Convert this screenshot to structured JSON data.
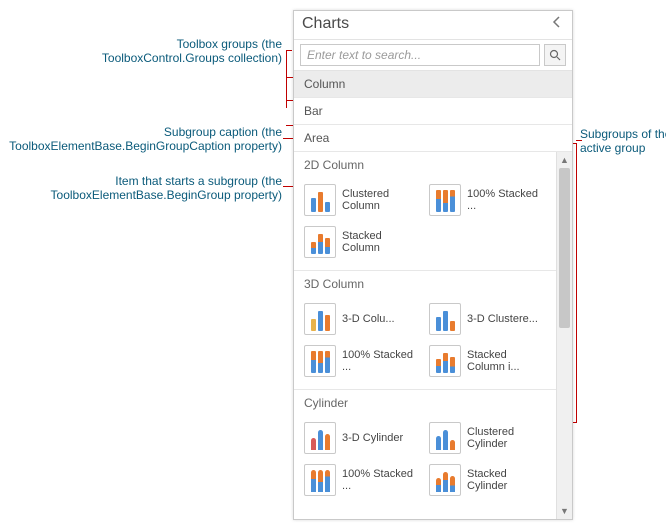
{
  "panel": {
    "title": "Charts"
  },
  "search": {
    "placeholder": "Enter text to search..."
  },
  "groups": {
    "column": "Column",
    "bar": "Bar",
    "area": "Area"
  },
  "subgroups": {
    "s2d": {
      "caption": "2D Column",
      "items": {
        "clustered": "Clustered Column",
        "stacked100": "100% Stacked ...",
        "stacked": "Stacked Column"
      }
    },
    "s3d": {
      "caption": "3D Column",
      "items": {
        "col3d": "3-D Colu...",
        "clust3d": "3-D Clustere...",
        "stacked100_3d": "100% Stacked ...",
        "stackedin": "Stacked Column i..."
      }
    },
    "cyl": {
      "caption": "Cylinder",
      "items": {
        "cyl3d": "3-D Cylinder",
        "clustcyl": "Clustered Cylinder",
        "stacked100cyl": "100% Stacked ...",
        "stackedcyl": "Stacked Cylinder"
      }
    }
  },
  "annotations": {
    "groups": "Toolbox groups (the\nToolboxControl.Groups collection)",
    "subcaption": "Subgroup caption (the\nToolboxElementBase.BeginGroupCaption property)",
    "startitem": "Item that starts a subgroup (the\nToolboxElementBase.BeginGroup property)",
    "right": "Subgroups of the\nactive group"
  }
}
